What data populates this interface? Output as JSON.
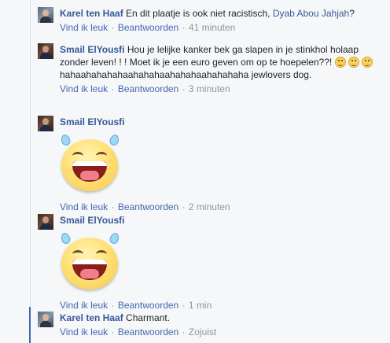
{
  "actions": {
    "like": "Vind ik leuk",
    "reply": "Beantwoorden",
    "separator": "·"
  },
  "comments": [
    {
      "author": "Karel ten Haaf",
      "text": "En dit plaatje is ook niet racistisch,",
      "mention": "Dyab Abou Jahjah",
      "text_after": "?",
      "time": "41 minuten"
    },
    {
      "author": "Smail ElYousfi",
      "text": "Hou je lelijke kanker bek ga slapen in je stinkhol holaap zonder leven! ! ! Moet ik je een euro geven om op te hoepelen??!",
      "emoji": [
        "smile-emoji",
        "smile-emoji",
        "smile-emoji"
      ],
      "text_after": "hahaahahahahaahahahaahahahaahahahaha jewlovers dog.",
      "time": "3 minuten"
    },
    {
      "author": "Smail ElYousfi",
      "sticker": "laughing-tears-sticker",
      "time": "2 minuten"
    },
    {
      "author": "Smail ElYousfi",
      "sticker": "laughing-tears-sticker",
      "time": "1 min"
    },
    {
      "author": "Karel ten Haaf",
      "text": "Charmant.",
      "time": "Zojuist"
    }
  ],
  "colors": {
    "link": "#365899",
    "meta": "#90949c",
    "active_thread": "#4267b2"
  }
}
